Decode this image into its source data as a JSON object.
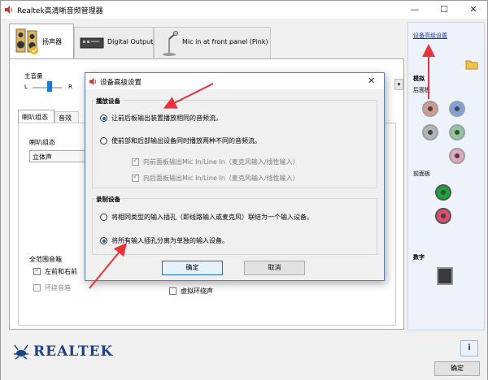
{
  "window": {
    "title": "Realtek高清晰音频管理器",
    "minimize": "—",
    "maximize": "☐",
    "close": "✕"
  },
  "tabs": [
    {
      "label": "扬声器"
    },
    {
      "label": "Digital Output"
    },
    {
      "label": "Mic in at front panel (Pink)"
    }
  ],
  "main": {
    "volume_label": "主音量",
    "left": "L",
    "right": "R",
    "subtabs": [
      "喇叭组态",
      "音效"
    ],
    "speaker_config_label": "喇叭组态",
    "speaker_config_value": "立体声",
    "fullrange_label": "全范围音箱",
    "fullrange_front": "左前和右前",
    "fullrange_surround": "环绕音箱",
    "virtual_surround": "虚拟环绕声"
  },
  "right_panel": {
    "advanced_link": "设备高级设置",
    "analog_label": "模拟",
    "rear_label": "后面板",
    "front_label": "前面板",
    "digital_label": "数字"
  },
  "bottom": {
    "brand": "REALTEK",
    "ok": "确定",
    "info": "i"
  },
  "dialog": {
    "title": "设备高级设置",
    "playback_group": "播放设备",
    "playback_opt1": "让前后板输出装置播放相同的音频流。",
    "playback_opt2": "使前部和后部输出设备同时播放两种不同的音频流。",
    "playback_sub1": "向前面板输出Mic In/Line In（麦克风输入/线性输入）",
    "playback_sub2": "向后面板输出Mic In/Line In（麦克风输入/线性输入）",
    "record_group": "录制设备",
    "record_opt1": "将相同类型的输入插孔（即线路输入或麦克风）联结为一个输入设备。",
    "record_opt2": "将所有输入插孔分离为单独的输入设备。",
    "ok": "确定",
    "cancel": "取消",
    "close": "✕"
  },
  "colors": {
    "accent_red": "#e8323c",
    "realtek_blue": "#1e3f8a",
    "link_blue": "#1b3b8f"
  }
}
